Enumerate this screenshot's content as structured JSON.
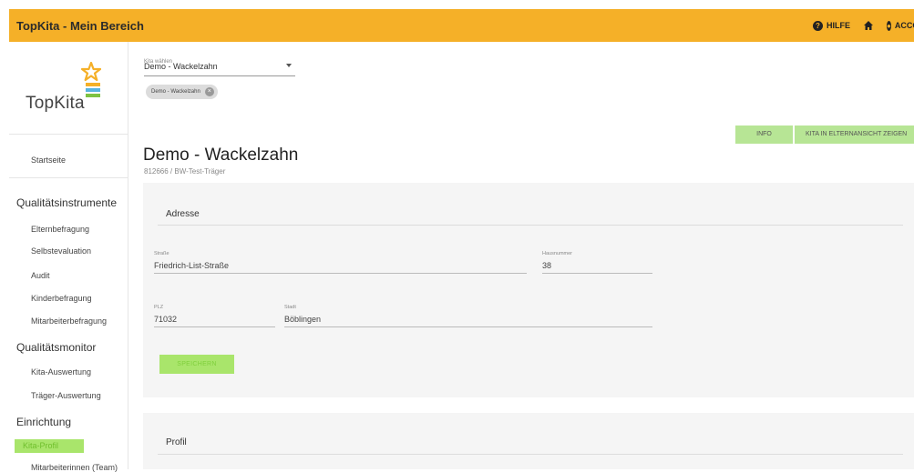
{
  "header": {
    "brand": "TopKita - Mein Bereich",
    "help_label": "HILFE",
    "account_label": "ACCOUNT"
  },
  "logo": {
    "text": "TopKita"
  },
  "sidebar": {
    "startseite": "Startseite",
    "sections": [
      {
        "heading": "Qualitätsinstrumente",
        "items": [
          "Elternbefragung",
          "Selbstevaluation",
          "Audit",
          "Kinderbefragung",
          "Mitarbeiterbefragung"
        ]
      },
      {
        "heading": "Qualitätsmonitor",
        "items": [
          "Kita-Auswertung",
          "Träger-Auswertung"
        ]
      },
      {
        "heading": "Einrichtung",
        "items": [
          "Kita-Profil",
          "Mitarbeiterinnen (Team)"
        ]
      }
    ]
  },
  "kita_select": {
    "label": "Kita wählen",
    "value": "Demo - Wackelzahn",
    "chip": "Demo - Wackelzahn"
  },
  "actions": {
    "info": "INFO",
    "eltern": "KITA IN ELTERNANSICHT ZEIGEN"
  },
  "page": {
    "title": "Demo - Wackelzahn",
    "subtitle": "812666 / BW-Test-Träger"
  },
  "address": {
    "title": "Adresse",
    "street_label": "Straße",
    "street": "Friedrich-List-Straße",
    "number_label": "Hausnummer",
    "number": "38",
    "plz_label": "PLZ",
    "plz": "71032",
    "city_label": "Stadt",
    "city": "Böblingen",
    "save": "SPEICHERN"
  },
  "profil": {
    "title": "Profil"
  },
  "colors": {
    "topbar": "#f5b028",
    "highlight": "#a9e56b"
  }
}
